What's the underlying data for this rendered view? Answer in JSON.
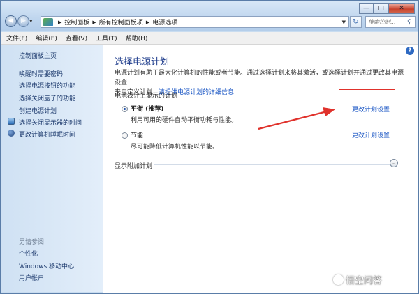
{
  "address": {
    "crumbs": [
      "控制面板",
      "所有控制面板项",
      "电源选项"
    ],
    "search_placeholder": "搜索控制..."
  },
  "caption_buttons": {
    "minimize": "—",
    "maximize": "□",
    "close": "✕"
  },
  "menu": [
    "文件(F)",
    "编辑(E)",
    "查看(V)",
    "工具(T)",
    "帮助(H)"
  ],
  "sidebar": {
    "home": "控制面板主页",
    "links": [
      "唤醒时需要密码",
      "选择电源按钮的功能",
      "选择关闭盖子的功能",
      "创建电源计划"
    ],
    "icon_links": [
      {
        "label": "选择关闭显示器的时间",
        "icon": "monitor-icon"
      },
      {
        "label": "更改计算机睡眠时间",
        "icon": "moon-icon"
      }
    ],
    "see_also_title": "另请参阅",
    "see_also": [
      "个性化",
      "Windows 移动中心",
      "用户帐户"
    ]
  },
  "main": {
    "title": "选择电源计划",
    "desc_line1": "电源计划有助于最大化计算机的性能或者节能。通过选择计划来将其激活，或选择计划并通过更改其电源设置",
    "desc_line2_prefix": "来自定义计划。",
    "desc_link": "请提供电源计划的详细信息",
    "group_label": "电池表计上显示的计划",
    "plans": [
      {
        "name": "平衡 (推荐)",
        "desc": "利用可用的硬件自动平衡功耗与性能。",
        "selected": true,
        "change_label": "更改计划设置"
      },
      {
        "name": "节能",
        "desc": "尽可能降低计算机性能以节能。",
        "selected": false,
        "change_label": "更改计划设置"
      }
    ],
    "more_plans": "显示附加计划",
    "help_icon": "?"
  },
  "annotation": {
    "color": "#e0322c"
  },
  "watermark": "悟空问答",
  "colors": {
    "link": "#1a56c4",
    "title": "#1f3d8c",
    "sidebar_link": "#1e3b6e",
    "close": "#c7412c"
  }
}
